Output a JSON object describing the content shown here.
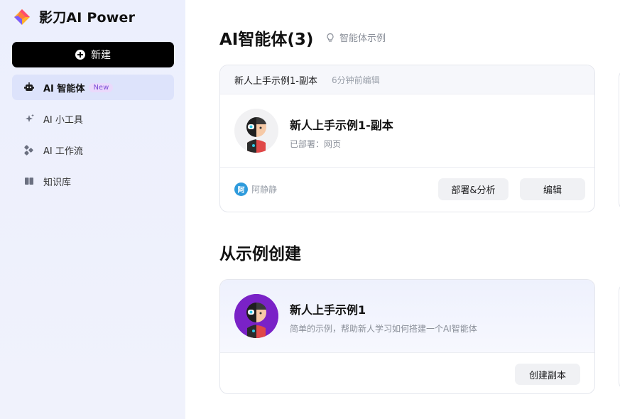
{
  "sidebar": {
    "brand": "影刀AI Power",
    "new_button": "新建",
    "items": [
      {
        "label": "AI 智能体",
        "badge": "New",
        "icon": "robot-icon",
        "active": true
      },
      {
        "label": "AI 小工具",
        "icon": "sparkle-icon"
      },
      {
        "label": "AI 工作流",
        "icon": "workflow-icon"
      },
      {
        "label": "知识库",
        "icon": "book-icon"
      }
    ]
  },
  "main": {
    "agents_title": "AI智能体(3)",
    "example_link": "智能体示例",
    "agent_card": {
      "header_name": "新人上手示例1-副本",
      "edited": "6分钟前编辑",
      "name": "新人上手示例1-副本",
      "status": "已部署：网页",
      "owner_initial": "阿",
      "owner": "阿静静",
      "deploy_button": "部署&分析",
      "edit_button": "编辑"
    },
    "examples_title": "从示例创建",
    "example_card": {
      "name": "新人上手示例1",
      "description": "简单的示例，帮助新人学习如何搭建一个AI智能体",
      "copy_button": "创建副本"
    }
  },
  "colors": {
    "sidebar_bg": "#eceffd",
    "active_item_bg": "#dde3fb",
    "primary_button": "#000000",
    "badge_bg": "#ead9fb",
    "owner_avatar": "#2f9bdc",
    "example_avatar_bg": "#7a22c7"
  }
}
